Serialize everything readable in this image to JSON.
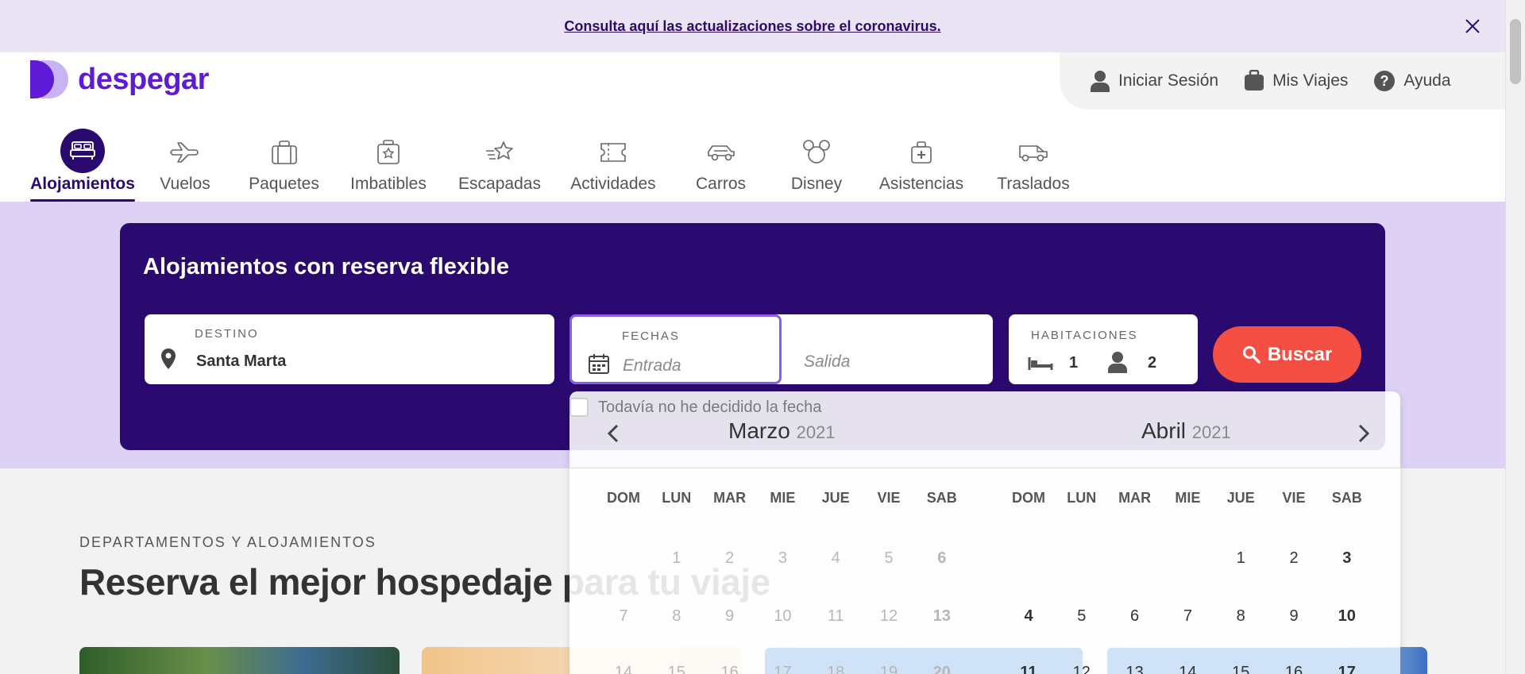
{
  "banner": {
    "text": "Consulta aquí las actualizaciones sobre el coronavirus."
  },
  "logo": {
    "text": "despegar"
  },
  "user_menu": {
    "login": "Iniciar Sesión",
    "trips": "Mis Viajes",
    "help": "Ayuda"
  },
  "nav": {
    "items": [
      {
        "label": "Alojamientos",
        "icon": "bed-icon",
        "active": true
      },
      {
        "label": "Vuelos",
        "icon": "plane-icon"
      },
      {
        "label": "Paquetes",
        "icon": "suitcase-icon"
      },
      {
        "label": "Imbatibles",
        "icon": "star-luggage-icon"
      },
      {
        "label": "Escapadas",
        "icon": "shooting-star-icon"
      },
      {
        "label": "Actividades",
        "icon": "ticket-icon"
      },
      {
        "label": "Carros",
        "icon": "car-icon"
      },
      {
        "label": "Disney",
        "icon": "mickey-icon"
      },
      {
        "label": "Asistencias",
        "icon": "medical-bag-icon"
      },
      {
        "label": "Traslados",
        "icon": "shuttle-icon"
      }
    ]
  },
  "search": {
    "title": "Alojamientos con reserva flexible",
    "destination_label": "DESTINO",
    "destination_value": "Santa Marta",
    "dates_label": "FECHAS",
    "checkin_placeholder": "Entrada",
    "checkout_placeholder": "Salida",
    "rooms_label": "HABITACIONES",
    "rooms_count": "1",
    "guests_count": "2",
    "button": "Buscar"
  },
  "calendar": {
    "undecided": "Todavía no he decidido la fecha",
    "weekdays": [
      "DOM",
      "LUN",
      "MAR",
      "MIE",
      "JUE",
      "VIE",
      "SAB"
    ],
    "months": [
      {
        "name": "Marzo",
        "year": "2021",
        "rows": [
          [
            "",
            "1",
            "2",
            "3",
            "4",
            "5",
            "6"
          ],
          [
            "7",
            "8",
            "9",
            "10",
            "11",
            "12",
            "13"
          ],
          [
            "14",
            "15",
            "16",
            "17",
            "18",
            "19",
            "20"
          ]
        ]
      },
      {
        "name": "Abril",
        "year": "2021",
        "rows": [
          [
            "",
            "",
            "",
            "",
            "1",
            "2",
            "3"
          ],
          [
            "4",
            "5",
            "6",
            "7",
            "8",
            "9",
            "10"
          ],
          [
            "11",
            "12",
            "13",
            "14",
            "15",
            "16",
            "17"
          ]
        ]
      }
    ]
  },
  "content": {
    "kicker": "DEPARTAMENTOS Y ALOJAMIENTOS",
    "title": "Reserva el mejor hospedaje para tu viaje"
  },
  "colors": {
    "brand": "#5d1bd6",
    "search_card": "#2a0a6e",
    "cta": "#f54f43",
    "hero_bg": "#ddd1f5"
  }
}
